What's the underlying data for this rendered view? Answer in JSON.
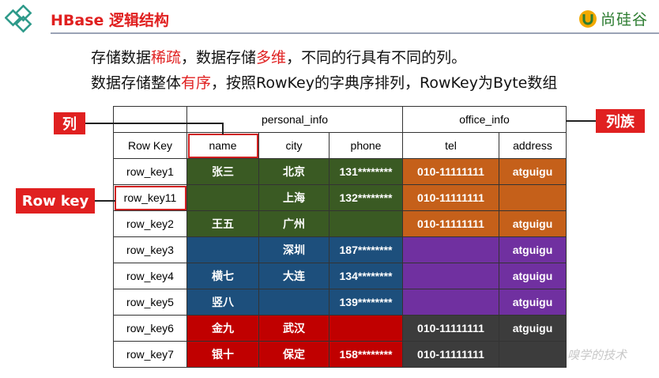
{
  "title": "HBase 逻辑结构",
  "brand": {
    "text": "尚硅谷"
  },
  "lines": {
    "l1_a": "存储数据",
    "l1_b": "稀疏",
    "l1_c": "，数据存储",
    "l1_d": "多维",
    "l1_e": "，不同的行具有不同的列。",
    "l2_a": "数据存储整体",
    "l2_b": "有序",
    "l2_c": "，按照RowKey的字典序排列，RowKey为Byte数组"
  },
  "callouts": {
    "column": "列",
    "column_family": "列族",
    "row_key": "Row key"
  },
  "table": {
    "families": [
      "personal_info",
      "office_info"
    ],
    "headers": [
      "Row Key",
      "name",
      "city",
      "phone",
      "tel",
      "address"
    ],
    "rows": [
      [
        "row_key1",
        "张三",
        "北京",
        "131********",
        "010-11111111",
        "atguigu"
      ],
      [
        "row_key11",
        "",
        "上海",
        "132********",
        "010-11111111",
        ""
      ],
      [
        "row_key2",
        "王五",
        "广州",
        "",
        "010-11111111",
        "atguigu"
      ],
      [
        "row_key3",
        "",
        "深圳",
        "187********",
        "",
        "atguigu"
      ],
      [
        "row_key4",
        "横七",
        "大连",
        "134********",
        "",
        "atguigu"
      ],
      [
        "row_key5",
        "竖八",
        "",
        "139********",
        "",
        "atguigu"
      ],
      [
        "row_key6",
        "金九",
        "武汉",
        "",
        "010-11111111",
        "atguigu"
      ],
      [
        "row_key7",
        "银十",
        "保定",
        "158********",
        "010-11111111",
        ""
      ]
    ]
  },
  "watermark": "嗅学的技术",
  "colors": {
    "accent": "#e02020",
    "green": "#3a5a23",
    "orange": "#c5601a",
    "blue": "#1d4f7c",
    "purple": "#7030a0",
    "red": "#c00000",
    "dark": "#3c3c3c"
  }
}
